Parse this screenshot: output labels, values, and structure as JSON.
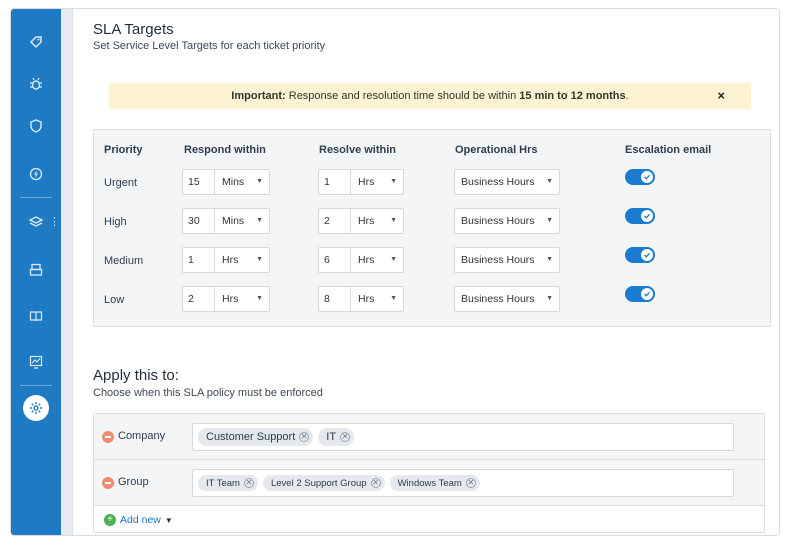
{
  "sidebar": {
    "items": [
      {
        "icon": "tag-icon",
        "glyph": "⬗"
      },
      {
        "icon": "bug-icon",
        "glyph": "✲"
      },
      {
        "icon": "shield-icon",
        "glyph": "⛉"
      },
      {
        "icon": "lightning-icon",
        "glyph": "ϟ"
      },
      {
        "icon": "layers-icon",
        "glyph": "≋"
      },
      {
        "icon": "printer-icon",
        "glyph": "⎙"
      },
      {
        "icon": "book-icon",
        "glyph": "▭"
      },
      {
        "icon": "chart-icon",
        "glyph": "⌗"
      },
      {
        "icon": "settings-icon",
        "glyph": "⚙"
      }
    ]
  },
  "header": {
    "title": "SLA Targets",
    "subtitle": "Set Service Level Targets for each ticket priority"
  },
  "banner": {
    "lead": "Important:",
    "text": " Response and resolution time should be within ",
    "range": "15 min to 12 months",
    "tail": ".",
    "close": "×"
  },
  "table": {
    "headers": {
      "priority": "Priority",
      "respond": "Respond within",
      "resolve": "Resolve within",
      "hours": "Operational Hrs",
      "escalation": "Escalation email"
    },
    "rows": [
      {
        "priority": "Urgent",
        "respond_value": "15",
        "respond_unit": "Mins",
        "resolve_value": "1",
        "resolve_unit": "Hrs",
        "hours": "Business Hours",
        "escalation": true
      },
      {
        "priority": "High",
        "respond_value": "30",
        "respond_unit": "Mins",
        "resolve_value": "2",
        "resolve_unit": "Hrs",
        "hours": "Business Hours",
        "escalation": true
      },
      {
        "priority": "Medium",
        "respond_value": "1",
        "respond_unit": "Hrs",
        "resolve_value": "6",
        "resolve_unit": "Hrs",
        "hours": "Business Hours",
        "escalation": true
      },
      {
        "priority": "Low",
        "respond_value": "2",
        "respond_unit": "Hrs",
        "resolve_value": "8",
        "resolve_unit": "Hrs",
        "hours": "Business Hours",
        "escalation": true
      }
    ]
  },
  "apply": {
    "title": "Apply this to:",
    "subtitle": "Choose when this SLA policy must be enforced",
    "conditions": [
      {
        "label": "Company",
        "tags": [
          "Customer Support",
          "IT"
        ]
      },
      {
        "label": "Group",
        "tags": [
          "IT Team",
          "Level 2 Support Group",
          "Windows Team"
        ]
      }
    ],
    "add_new": "Add new"
  }
}
